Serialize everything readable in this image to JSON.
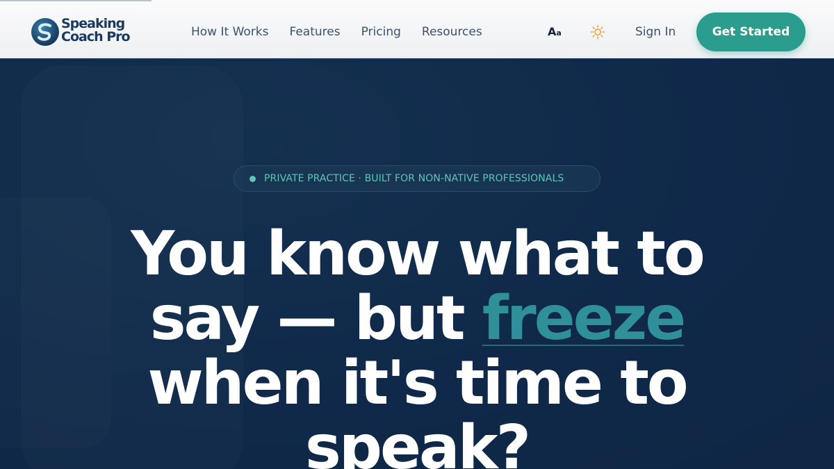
{
  "brand": {
    "name_line1": "Speaking",
    "name_line2": "Coach Pro"
  },
  "nav": {
    "items": [
      {
        "label": "How It Works"
      },
      {
        "label": "Features"
      },
      {
        "label": "Pricing"
      },
      {
        "label": "Resources"
      }
    ],
    "font_toggle_big": "A",
    "font_toggle_small": "a",
    "sign_in": "Sign In",
    "cta": "Get Started"
  },
  "hero": {
    "badge": "PRIVATE PRACTICE · BUILT FOR NON-NATIVE PROFESSIONALS",
    "headline_part1": "You know what to say — but ",
    "headline_accent": "freeze",
    "headline_part2": " when it's time to speak?"
  },
  "icons": {
    "theme": "sun-icon",
    "logo": "swirl-logo-icon"
  },
  "colors": {
    "accent": "#2a9d8f",
    "hero_bg": "#112a47",
    "badge_text": "#5fc5b7",
    "headline_accent": "#2f8f9a"
  }
}
